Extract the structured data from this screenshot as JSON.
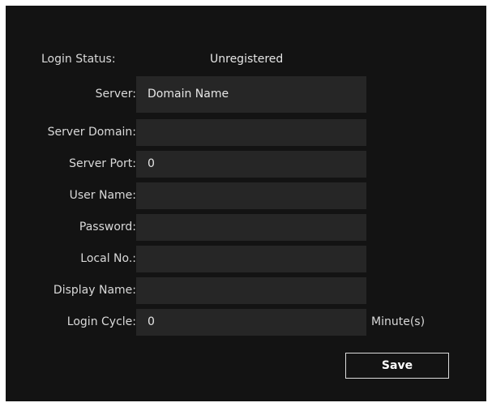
{
  "status": {
    "label": "Login Status:",
    "value": "Unregistered"
  },
  "fields": {
    "server": {
      "label": "Server:",
      "value": "Domain Name"
    },
    "server_domain": {
      "label": "Server Domain:",
      "value": ""
    },
    "server_port": {
      "label": "Server Port:",
      "value": "0"
    },
    "user_name": {
      "label": "User Name:",
      "value": ""
    },
    "password": {
      "label": "Password:",
      "value": ""
    },
    "local_no": {
      "label": "Local No.:",
      "value": ""
    },
    "display_name": {
      "label": "Display Name:",
      "value": ""
    },
    "login_cycle": {
      "label": "Login Cycle:",
      "value": "0",
      "unit": "Minute(s)"
    }
  },
  "actions": {
    "save_label": "Save"
  },
  "colors": {
    "panel_background": "#131313",
    "field_background": "#262626",
    "text": "#d9d9d9"
  }
}
